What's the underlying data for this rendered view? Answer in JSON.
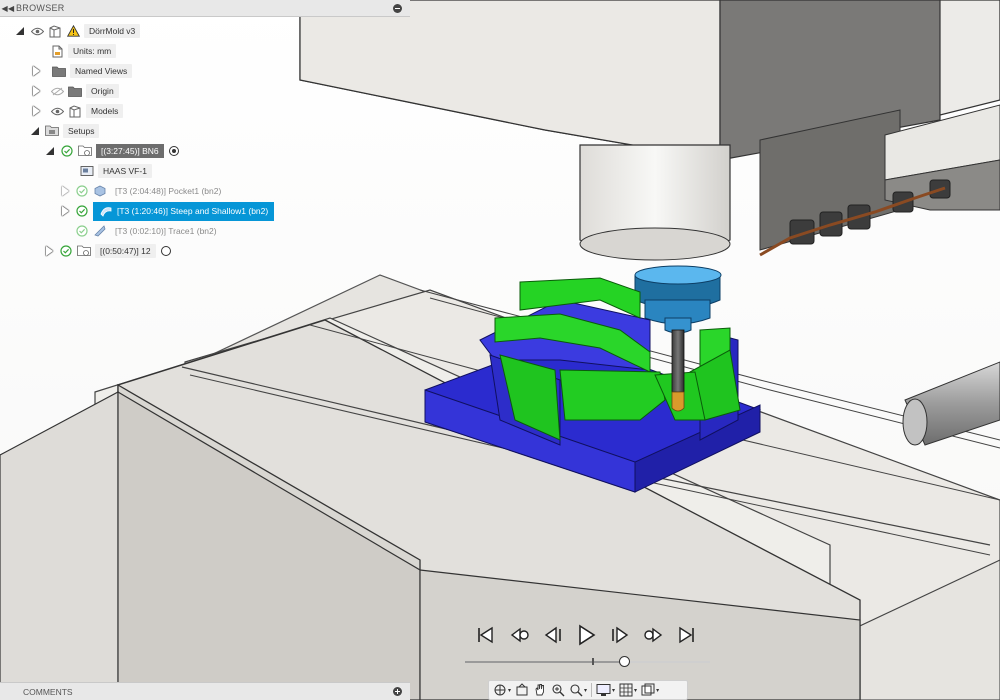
{
  "browser": {
    "title": "BROWSER",
    "tree": {
      "root": {
        "label": "DörrMold v3"
      },
      "units": {
        "label": "Units: mm"
      },
      "named_views": {
        "label": "Named Views"
      },
      "origin": {
        "label": "Origin"
      },
      "models": {
        "label": "Models"
      },
      "setups": {
        "label": "Setups"
      },
      "setup1": {
        "label": "[(3:27:45)] BN6"
      },
      "machine": {
        "label": "HAAS VF-1"
      },
      "ops": [
        {
          "label": "[T3 (2:04:48)] Pocket1 (bn2)"
        },
        {
          "label": "[T3 (1:20:46)] Steep and Shallow1 (bn2)"
        },
        {
          "label": "[T3 (0:02:10)] Trace1 (bn2)"
        }
      ],
      "setup2": {
        "label": "[(0:50:47)] 12"
      }
    }
  },
  "comments": {
    "title": "COMMENTS"
  },
  "playback": {
    "position": 0.65,
    "marker": 0.5
  },
  "colors": {
    "accent": "#0696d7",
    "stock_green": "#1ed21a",
    "part_blue": "#2f2fd6",
    "tool_orange": "#d99a2b",
    "machine_gray": "#e9e7e3"
  }
}
